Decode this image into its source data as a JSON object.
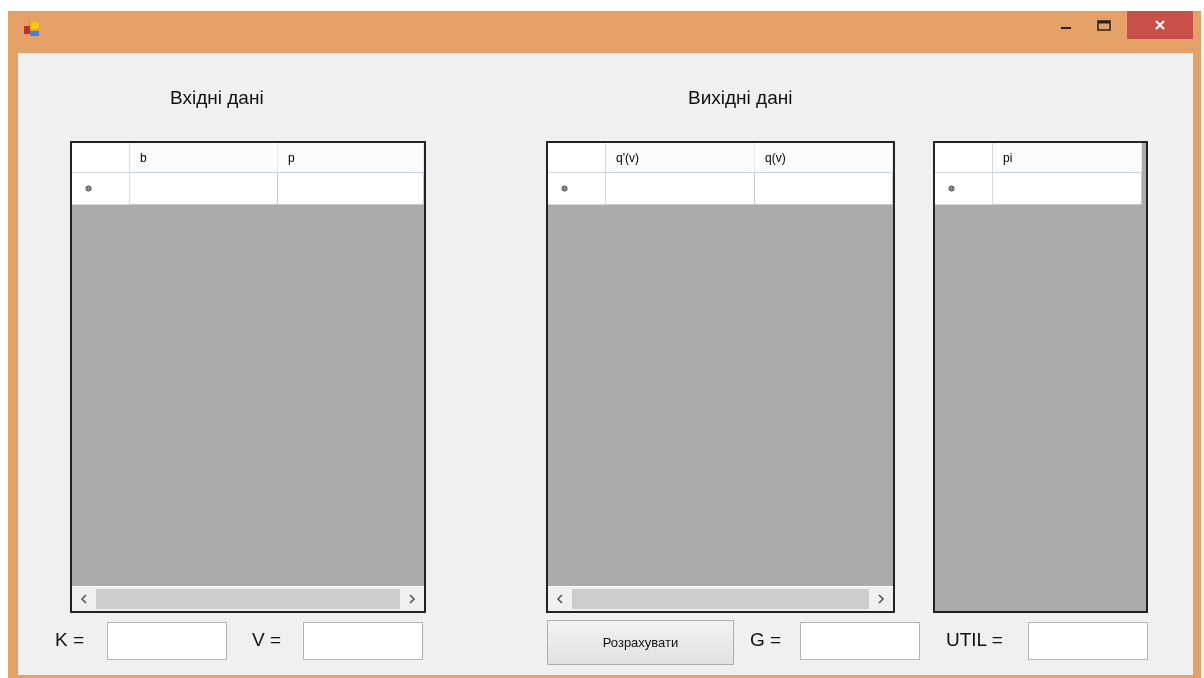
{
  "window": {
    "controls": [
      {
        "kind": "minimize"
      },
      {
        "kind": "maximize"
      },
      {
        "kind": "close"
      }
    ]
  },
  "headings": [
    "Вхідні дані",
    "Вихідні дані"
  ],
  "grids": [
    {
      "columns": [
        "b",
        "p"
      ],
      "new_row_marker": true,
      "horizontal_scrollbar": true
    },
    {
      "columns": [
        "q'(v)",
        "q(v)"
      ],
      "new_row_marker": true,
      "horizontal_scrollbar": true
    },
    {
      "columns": [
        "pi"
      ],
      "new_row_marker": true,
      "horizontal_scrollbar": false
    }
  ],
  "fields": [
    {
      "label": "K ="
    },
    {
      "label": "V ="
    },
    {
      "label": "G ="
    },
    {
      "label": "UTIL ="
    }
  ],
  "button": {
    "label": "Розрахувати"
  }
}
